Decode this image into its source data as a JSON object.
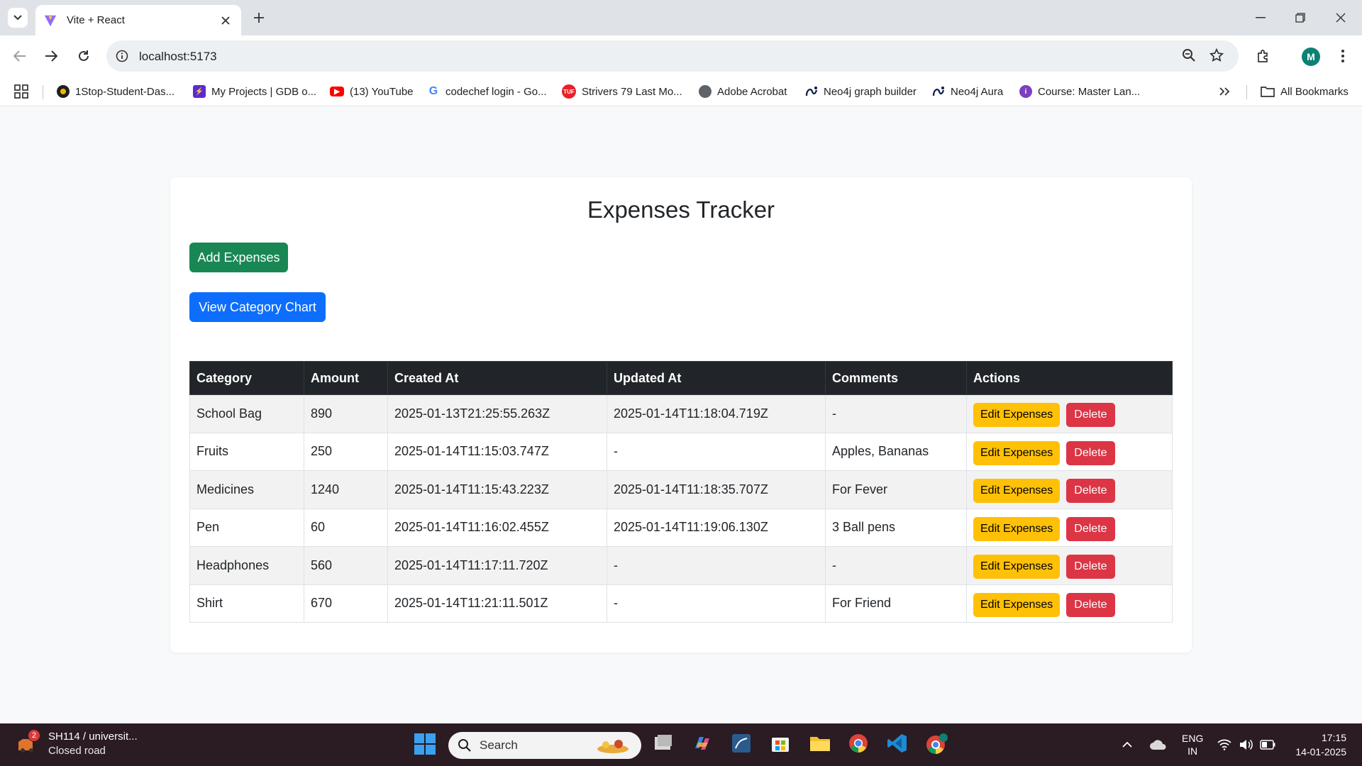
{
  "browser": {
    "tab_title": "Vite + React",
    "url": "localhost:5173",
    "profile_initial": "M",
    "bookmarks": [
      "1Stop-Student-Das...",
      "My Projects | GDB o...",
      "(13) YouTube",
      "codechef login - Go...",
      "Strivers 79 Last Mo...",
      "Adobe Acrobat",
      "Neo4j graph builder",
      "Neo4j Aura",
      "Course: Master Lan..."
    ],
    "all_bookmarks": "All Bookmarks"
  },
  "page": {
    "title": "Expenses Tracker",
    "add_button": "Add Expenses",
    "chart_button": "View Category Chart",
    "table": {
      "headers": [
        "Category",
        "Amount",
        "Created At",
        "Updated At",
        "Comments",
        "Actions"
      ],
      "rows": [
        {
          "category": "School Bag",
          "amount": "890",
          "created": "2025-01-13T21:25:55.263Z",
          "updated": "2025-01-14T11:18:04.719Z",
          "comments": "-"
        },
        {
          "category": "Fruits",
          "amount": "250",
          "created": "2025-01-14T11:15:03.747Z",
          "updated": "-",
          "comments": "Apples, Bananas"
        },
        {
          "category": "Medicines",
          "amount": "1240",
          "created": "2025-01-14T11:15:43.223Z",
          "updated": "2025-01-14T11:18:35.707Z",
          "comments": "For Fever"
        },
        {
          "category": "Pen",
          "amount": "60",
          "created": "2025-01-14T11:16:02.455Z",
          "updated": "2025-01-14T11:19:06.130Z",
          "comments": "3 Ball pens"
        },
        {
          "category": "Headphones",
          "amount": "560",
          "created": "2025-01-14T11:17:11.720Z",
          "updated": "-",
          "comments": "-"
        },
        {
          "category": "Shirt",
          "amount": "670",
          "created": "2025-01-14T11:21:11.501Z",
          "updated": "-",
          "comments": "For Friend"
        }
      ],
      "edit_label": "Edit Expenses",
      "delete_label": "Delete"
    }
  },
  "taskbar": {
    "weather_title": "SH114 / universit...",
    "weather_sub": "Closed road",
    "weather_badge": "2",
    "search_label": "Search",
    "lang": "ENG",
    "region": "IN",
    "time": "17:15",
    "date": "14-01-2025"
  },
  "colors": {
    "add_button": "#198754",
    "chart_button": "#0d6efd",
    "edit_button": "#ffc107",
    "delete_button": "#dc3545",
    "table_header": "#212529"
  }
}
